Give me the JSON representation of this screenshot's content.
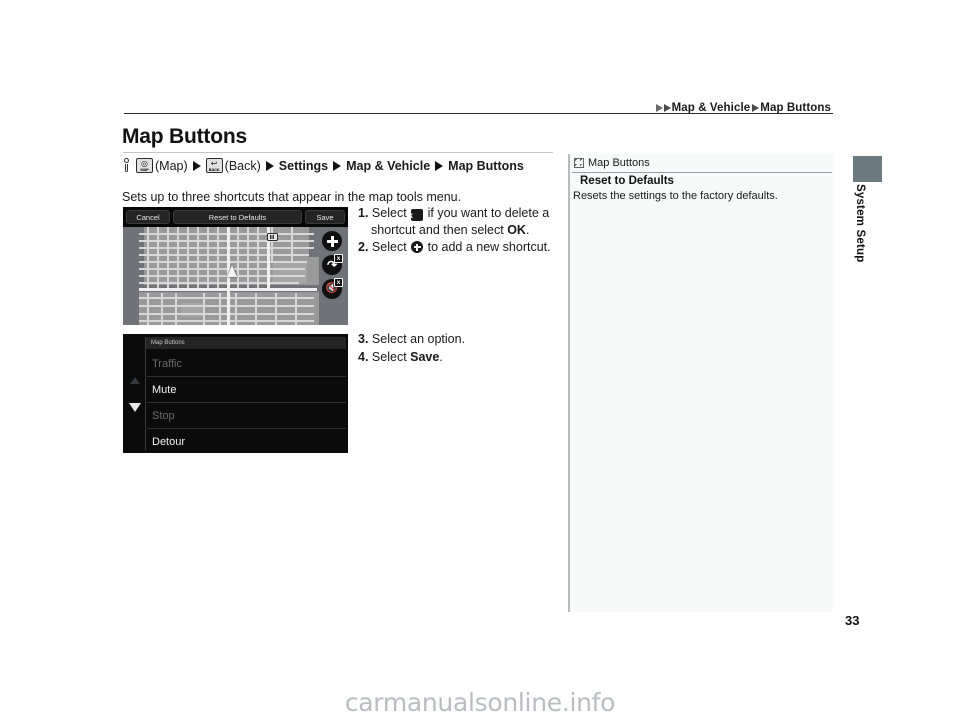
{
  "header": {
    "breadcrumb": [
      {
        "label": "Map & Vehicle"
      },
      {
        "label": "Map Buttons"
      }
    ]
  },
  "page": {
    "title": "Map Buttons",
    "intro": "Sets up to three shortcuts that appear in the map tools menu.",
    "number": "33",
    "watermark": "carmanualsonline.info"
  },
  "nav_path": {
    "key_icon": "key-icon",
    "map_button_label": "MAP",
    "map_text": "(Map)",
    "back_button_label": "BACK",
    "back_glyph": "↩",
    "back_text": "(Back)",
    "settings": "Settings",
    "map_and_vehicle": "Map & Vehicle",
    "map_buttons": "Map Buttons"
  },
  "map_screenshot": {
    "topbar": {
      "cancel": "Cancel",
      "reset": "Reset to Defaults",
      "save": "Save"
    },
    "circle_buttons": [
      {
        "name": "add-shortcut",
        "glyph": "plus",
        "badge": ""
      },
      {
        "name": "detour-shortcut",
        "glyph": "detour",
        "badge": "x"
      },
      {
        "name": "mute-shortcut",
        "glyph": "mute",
        "badge": "x"
      }
    ]
  },
  "list_screenshot": {
    "title": "Map Buttons",
    "items": [
      {
        "label": "Traffic",
        "state": "dim"
      },
      {
        "label": "Mute",
        "state": "on"
      },
      {
        "label": "Stop",
        "state": "dim"
      },
      {
        "label": "Detour",
        "state": "on"
      }
    ]
  },
  "steps": {
    "group1": [
      {
        "num": "1.",
        "pre": "Select ",
        "icon": "x-box",
        "mid": " if you want to delete a shortcut and then select ",
        "strong": "OK",
        "post": "."
      },
      {
        "num": "2.",
        "pre": "Select ",
        "icon": "plus-circle",
        "mid": " to add a new shortcut.",
        "strong": "",
        "post": ""
      }
    ],
    "group2": [
      {
        "num": "3.",
        "pre": "Select an option.",
        "icon": "",
        "mid": "",
        "strong": "",
        "post": ""
      },
      {
        "num": "4.",
        "pre": "Select ",
        "icon": "",
        "mid": "",
        "strong": "Save",
        "post": "."
      }
    ]
  },
  "sidebar": {
    "header": "Map Buttons",
    "subtitle": "Reset to Defaults",
    "description": "Resets the settings to the factory defaults."
  },
  "section_tab": {
    "label": "System Setup",
    "color": "#6b7a80"
  }
}
